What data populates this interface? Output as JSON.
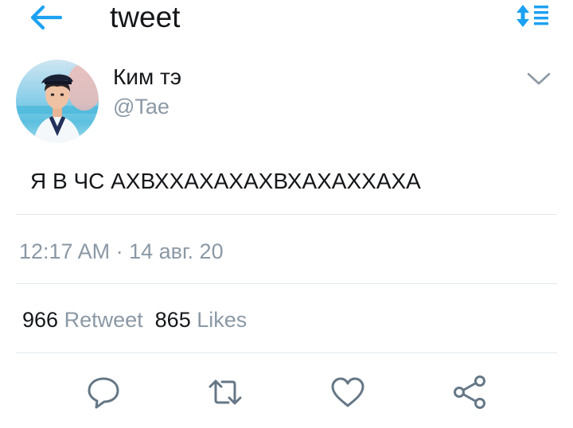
{
  "header": {
    "title": "tweet",
    "back_icon": "arrow-left-icon",
    "sort_icon": "sort-icon",
    "accent_color": "#1da1f2"
  },
  "author": {
    "name": "Ким тэ",
    "handle": "@Tae",
    "menu_icon": "chevron-down-icon"
  },
  "tweet": {
    "text": "Я В ЧС АХВХХАХАХАХВХАХАХХАХА",
    "time": "12:17 AM",
    "separator": "·",
    "date": "14 авг. 20"
  },
  "stats": {
    "retweets_count": "966",
    "retweets_label": "Retweet",
    "likes_count": "865",
    "likes_label": "Likes"
  },
  "actions": {
    "reply_icon": "reply-icon",
    "retweet_icon": "retweet-icon",
    "like_icon": "heart-icon",
    "share_icon": "share-icon"
  },
  "colors": {
    "text_primary": "#14171a",
    "text_secondary": "#8b98a5",
    "divider": "#e1e8ed",
    "icon": "#657786"
  }
}
